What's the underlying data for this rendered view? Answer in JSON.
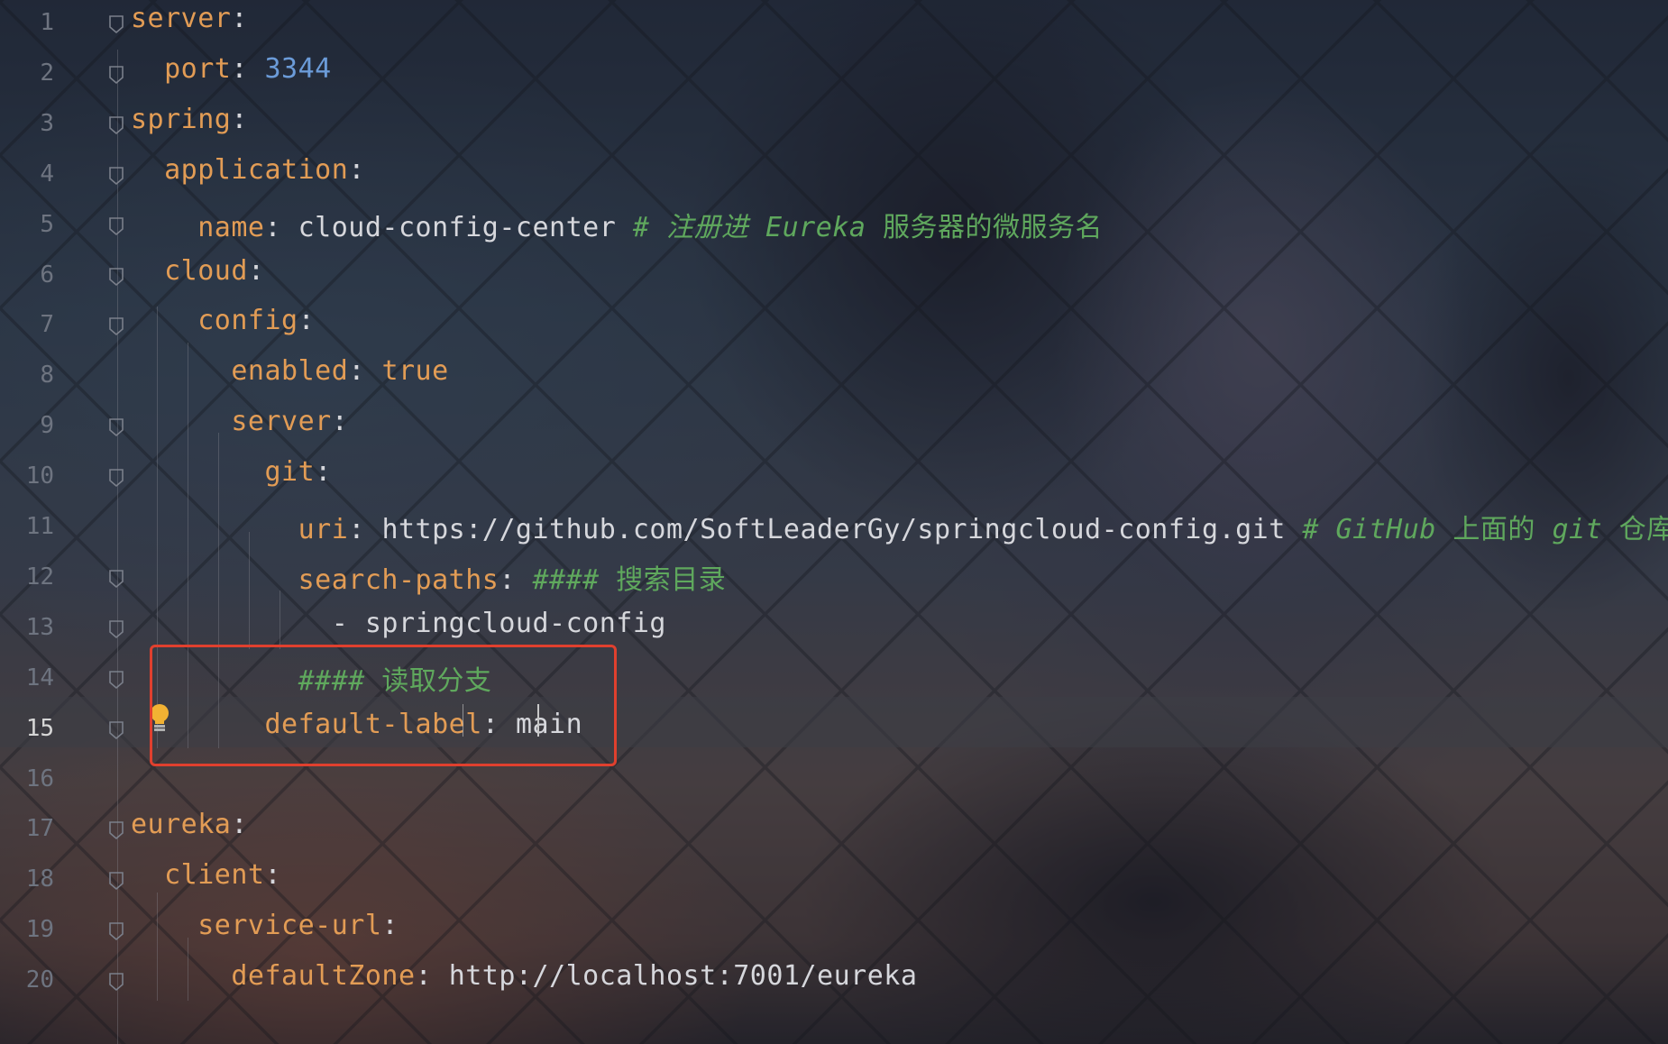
{
  "editor": {
    "language": "yaml",
    "active_line": 15,
    "colors": {
      "key": "#e29c55",
      "number": "#6b9bd8",
      "comment": "#5fa85d",
      "text": "#d6d7dc",
      "highlight_box": "#e0402e",
      "bulb": "#f2b233"
    },
    "lines": [
      {
        "num": "1",
        "tokens": [
          {
            "t": "k",
            "v": "server"
          },
          {
            "t": "p",
            "v": ":"
          }
        ]
      },
      {
        "num": "2",
        "tokens": [
          {
            "t": "p",
            "v": "  "
          },
          {
            "t": "k",
            "v": "port"
          },
          {
            "t": "p",
            "v": ": "
          },
          {
            "t": "n",
            "v": "3344"
          }
        ]
      },
      {
        "num": "3",
        "tokens": [
          {
            "t": "k",
            "v": "spring"
          },
          {
            "t": "p",
            "v": ":"
          }
        ]
      },
      {
        "num": "4",
        "tokens": [
          {
            "t": "p",
            "v": "  "
          },
          {
            "t": "k",
            "v": "application"
          },
          {
            "t": "p",
            "v": ":"
          }
        ]
      },
      {
        "num": "5",
        "tokens": [
          {
            "t": "p",
            "v": "    "
          },
          {
            "t": "k",
            "v": "name"
          },
          {
            "t": "p",
            "v": ": "
          },
          {
            "t": "s",
            "v": "cloud-config-center "
          },
          {
            "t": "c",
            "v": "# 注册进 "
          },
          {
            "t": "c",
            "v": "Eureka"
          },
          {
            "t": "c-cn",
            "v": " 服务器的微服务名"
          }
        ]
      },
      {
        "num": "6",
        "tokens": [
          {
            "t": "p",
            "v": "  "
          },
          {
            "t": "k",
            "v": "cloud"
          },
          {
            "t": "p",
            "v": ":"
          }
        ]
      },
      {
        "num": "7",
        "tokens": [
          {
            "t": "p",
            "v": "    "
          },
          {
            "t": "k",
            "v": "config"
          },
          {
            "t": "p",
            "v": ":"
          }
        ]
      },
      {
        "num": "8",
        "tokens": [
          {
            "t": "p",
            "v": "      "
          },
          {
            "t": "k",
            "v": "enabled"
          },
          {
            "t": "p",
            "v": ": "
          },
          {
            "t": "k",
            "v": "true"
          }
        ]
      },
      {
        "num": "9",
        "tokens": [
          {
            "t": "p",
            "v": "      "
          },
          {
            "t": "k",
            "v": "server"
          },
          {
            "t": "p",
            "v": ":"
          }
        ]
      },
      {
        "num": "10",
        "tokens": [
          {
            "t": "p",
            "v": "        "
          },
          {
            "t": "k",
            "v": "git"
          },
          {
            "t": "p",
            "v": ":"
          }
        ]
      },
      {
        "num": "11",
        "tokens": [
          {
            "t": "p",
            "v": "          "
          },
          {
            "t": "k",
            "v": "uri"
          },
          {
            "t": "p",
            "v": ": "
          },
          {
            "t": "s",
            "v": "https://github.com/SoftLeaderGy/springcloud-config.git "
          },
          {
            "t": "c",
            "v": "# GitHub"
          },
          {
            "t": "c-cn",
            "v": " 上面的 "
          },
          {
            "t": "c",
            "v": "git"
          },
          {
            "t": "c-cn",
            "v": " 仓库名字"
          }
        ]
      },
      {
        "num": "12",
        "tokens": [
          {
            "t": "p",
            "v": "          "
          },
          {
            "t": "k",
            "v": "search-paths"
          },
          {
            "t": "p",
            "v": ": "
          },
          {
            "t": "c",
            "v": "####"
          },
          {
            "t": "c-cn",
            "v": " 搜索目录"
          }
        ]
      },
      {
        "num": "13",
        "tokens": [
          {
            "t": "p",
            "v": "            - "
          },
          {
            "t": "s",
            "v": "springcloud-config"
          }
        ]
      },
      {
        "num": "14",
        "tokens": [
          {
            "t": "p",
            "v": "          "
          },
          {
            "t": "c",
            "v": "####"
          },
          {
            "t": "c-cn",
            "v": " 读取分支"
          }
        ]
      },
      {
        "num": "15",
        "tokens": [
          {
            "t": "p",
            "v": "        "
          },
          {
            "t": "k",
            "v": "default-label"
          },
          {
            "t": "p",
            "v": ": "
          },
          {
            "t": "s",
            "v": "main"
          }
        ]
      },
      {
        "num": "16",
        "tokens": []
      },
      {
        "num": "17",
        "tokens": [
          {
            "t": "k",
            "v": "eureka"
          },
          {
            "t": "p",
            "v": ":"
          }
        ]
      },
      {
        "num": "18",
        "tokens": [
          {
            "t": "p",
            "v": "  "
          },
          {
            "t": "k",
            "v": "client"
          },
          {
            "t": "p",
            "v": ":"
          }
        ]
      },
      {
        "num": "19",
        "tokens": [
          {
            "t": "p",
            "v": "    "
          },
          {
            "t": "k",
            "v": "service-url"
          },
          {
            "t": "p",
            "v": ":"
          }
        ]
      },
      {
        "num": "20",
        "tokens": [
          {
            "t": "p",
            "v": "      "
          },
          {
            "t": "k",
            "v": "defaultZone"
          },
          {
            "t": "p",
            "v": ": "
          },
          {
            "t": "s",
            "v": "http://localhost:7001/eureka"
          }
        ]
      }
    ],
    "fold_lines": [
      "1",
      "2",
      "3",
      "4",
      "5",
      "6",
      "7",
      "9",
      "10",
      "12",
      "13",
      "14",
      "15",
      "17",
      "18",
      "19",
      "20"
    ],
    "icons": {
      "bulb": "lightbulb-icon",
      "fold": "fold-arrow-icon"
    }
  }
}
